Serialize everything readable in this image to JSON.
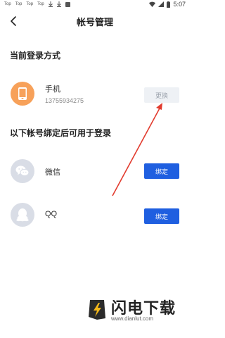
{
  "status_bar": {
    "left_items": [
      "Top",
      "Top",
      "Top",
      "Top"
    ],
    "time": "5:07"
  },
  "header": {
    "title": "帐号管理"
  },
  "current_login": {
    "section_title": "当前登录方式",
    "method_label": "手机",
    "phone_number": "13755934275",
    "change_button": "更换"
  },
  "bind_section": {
    "section_title": "以下帐号绑定后可用于登录",
    "items": [
      {
        "label": "微信",
        "button": "绑定",
        "icon": "wechat-icon"
      },
      {
        "label": "QQ",
        "button": "绑定",
        "icon": "qq-icon"
      }
    ]
  },
  "watermark": {
    "brand": "闪电下载",
    "url": "www.dianlut.com"
  },
  "colors": {
    "accent": "#1f5fe0",
    "phone_avatar": "#f7a15a",
    "avatar_gray": "#d9dde6",
    "annotation_arrow": "#e23b2e"
  }
}
